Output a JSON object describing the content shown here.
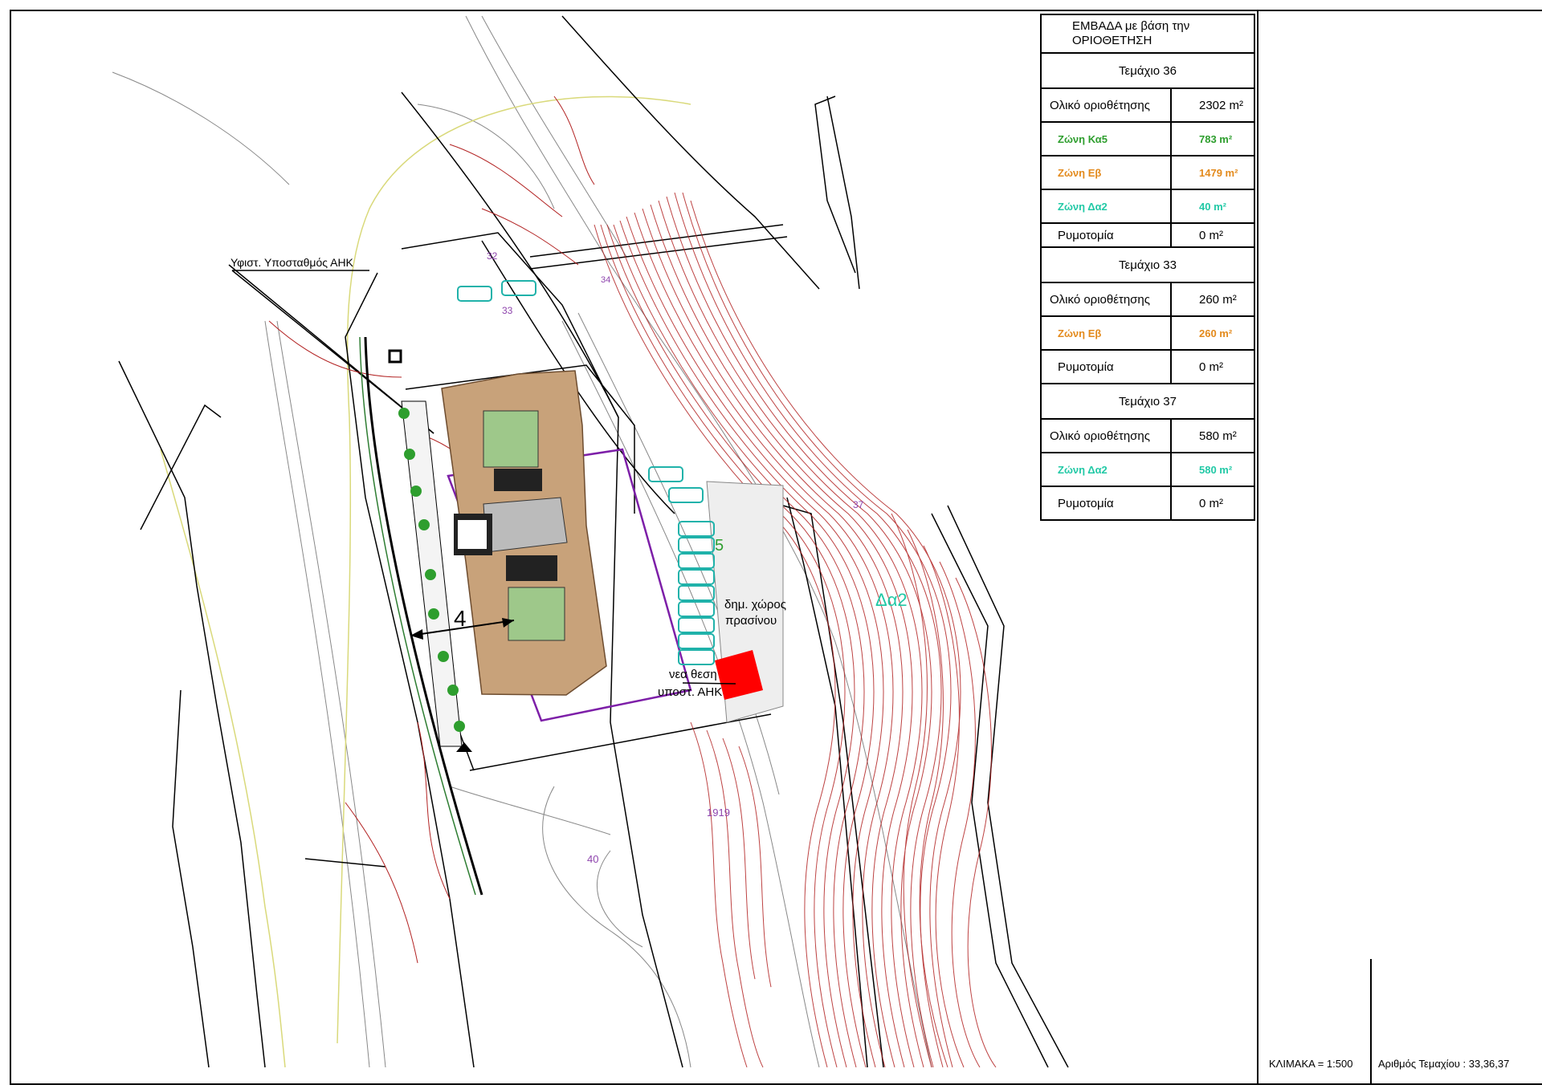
{
  "table": {
    "title_line1": "ΕΜΒΑΔΑ με βάση την",
    "title_line2": "ΟΡΙΟΘΕΤΗΣΗ",
    "sections": [
      {
        "header": "Τεμάχιο 36",
        "rows": [
          {
            "label": "Ολικό οριοθέτησης",
            "value": "2302 m²",
            "color": "#000000"
          },
          {
            "label": "Ζώνη Κα5",
            "value": "783 m²",
            "color": "#2e9e2e"
          },
          {
            "label": "Ζώνη Εβ",
            "value": "1479 m²",
            "color": "#e38a1c"
          },
          {
            "label": "Ζώνη Δα2",
            "value": "40 m²",
            "color": "#22c9a6"
          },
          {
            "label": "Ρυμοτομία",
            "value": "0 m²",
            "color": "#000000"
          }
        ]
      },
      {
        "header": "Τεμάχιο 33",
        "rows": [
          {
            "label": "Ολικό οριοθέτησης",
            "value": "260 m²",
            "color": "#000000"
          },
          {
            "label": "Ζώνη Εβ",
            "value": "260 m²",
            "color": "#e38a1c"
          },
          {
            "label": "Ρυμοτομία",
            "value": "0 m²",
            "color": "#000000"
          }
        ]
      },
      {
        "header": "Τεμάχιο 37",
        "rows": [
          {
            "label": "Ολικό οριοθέτησης",
            "value": "580 m²",
            "color": "#000000"
          },
          {
            "label": "Ζώνη Δα2",
            "value": "580 m²",
            "color": "#22c9a6"
          },
          {
            "label": "Ρυμοτομία",
            "value": "0 m²",
            "color": "#000000"
          }
        ]
      }
    ]
  },
  "map_labels": {
    "substation": "Υφιστ. Υποσταθμός ΑΗΚ",
    "green_space_line1": "δημ. χώρος",
    "green_space_line2": "πρασίνου",
    "new_position_line1": "νεα θεση",
    "new_position_line2": "υποστ. ΑΗΚ",
    "distance": "4",
    "zone_da2": "Δα2",
    "zone_ka5_fragment": "5",
    "parcel_32": "32",
    "parcel_33": "33",
    "parcel_34": "34",
    "parcel_37": "37",
    "parcel_40": "40",
    "parcel_1919": "1919"
  },
  "footer": {
    "scale": "ΚΛΙΜΑΚΑ = 1:500",
    "parcel_numbers": "Αριθμός Τεμαχίου : 33,36,37"
  },
  "colors": {
    "contour": "#b22222",
    "parcel_label": "#8e44ad",
    "purple_boundary": "#7d1fa8",
    "parking": "#20b2aa",
    "building": "#c8a27a",
    "trees": "#2e9e2e",
    "new_substation": "#ff0000",
    "yellow_line": "#d9d97a"
  }
}
